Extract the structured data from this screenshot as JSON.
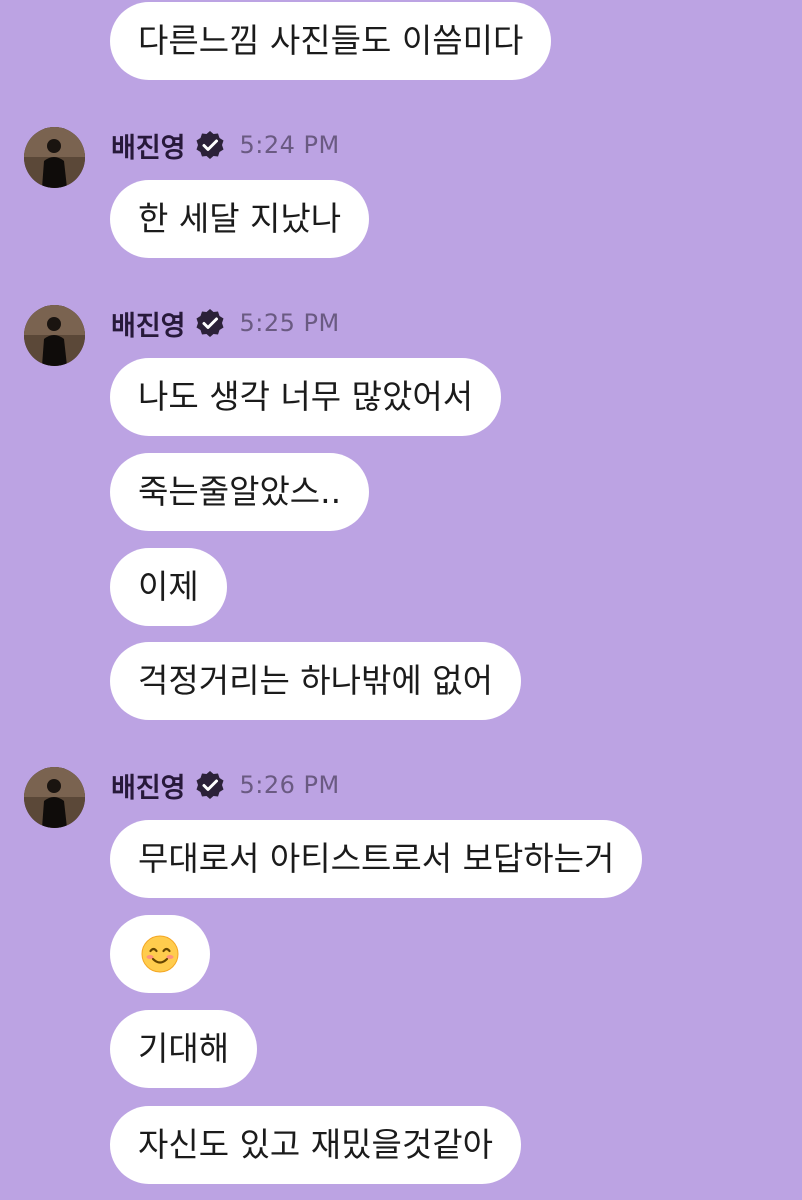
{
  "conversation": {
    "leading_message": {
      "text": "다른느낌 사진들도 이씀미다"
    },
    "groups": [
      {
        "sender": "배진영",
        "verified_icon": "verified-badge-icon",
        "time": "5:24 PM",
        "messages": [
          {
            "text": "한 세달 지났나"
          }
        ]
      },
      {
        "sender": "배진영",
        "verified_icon": "verified-badge-icon",
        "time": "5:25 PM",
        "messages": [
          {
            "text": "나도 생각 너무 많았어서"
          },
          {
            "text": "죽는줄알았스.."
          },
          {
            "text": "이제"
          },
          {
            "text": "걱정거리는 하나밖에 없어"
          }
        ]
      },
      {
        "sender": "배진영",
        "verified_icon": "verified-badge-icon",
        "time": "5:26 PM",
        "messages": [
          {
            "text": "무대로서 아티스트로서 보답하는거"
          },
          {
            "emoji": "smiling-face-icon"
          },
          {
            "text": "기대해"
          },
          {
            "text": "자신도 있고 재밌을것같아"
          }
        ]
      }
    ]
  },
  "colors": {
    "background": "#bca3e3",
    "bubble": "#ffffff",
    "text": "#1b1b1b",
    "timestamp": "#6a5a82"
  }
}
